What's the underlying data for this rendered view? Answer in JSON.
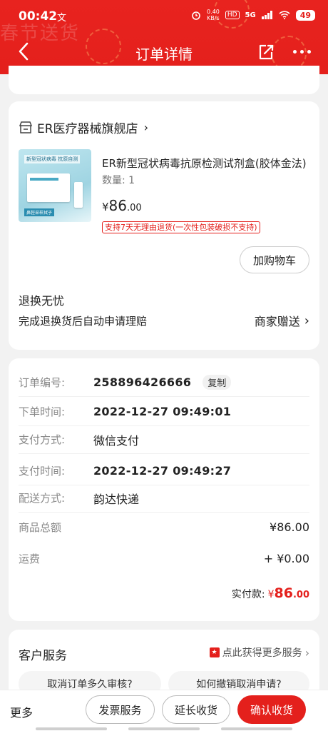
{
  "status_bar": {
    "time": "00:42",
    "speed_top": "0.40",
    "speed_bottom": "KB/s",
    "hd_tag": "HD",
    "net_tag": "5G",
    "battery": "49"
  },
  "header": {
    "title": "订单详情",
    "decoration": "春节送货"
  },
  "product_card": {
    "shop_name": "ER医疗器械旗舰店",
    "product_name": "ER新型冠状病毒抗原检测试剂盒(胶体金法)",
    "quantity": "数量: 1",
    "price_currency": "¥",
    "price_int": "86",
    "price_dec": ".00",
    "return_tag": "支持7天无理由退货(一次性包装破损不支持)",
    "add_cart_label": "加购物车",
    "worry_title": "退换无忧",
    "worry_desc": "完成退换货后自动申请理赔",
    "worry_right": "商家赠送",
    "thumb_band": "新型冠状病毒 抗原自测",
    "thumb_foot": "鼻腔采样拭子"
  },
  "order_info": {
    "order_no_label": "订单编号:",
    "order_no": "258896426666",
    "copy_label": "复制",
    "order_time_label": "下单时间:",
    "order_time": "2022-12-27 09:49:01",
    "pay_method_label": "支付方式:",
    "pay_method": "微信支付",
    "pay_time_label": "支付时间:",
    "pay_time": "2022-12-27 09:49:27",
    "ship_label": "配送方式:",
    "ship_method": "韵达快递",
    "goods_total_label": "商品总额",
    "goods_total": "¥86.00",
    "freight_label": "运费",
    "freight": "+ ¥0.00",
    "paid_label": "实付款:",
    "paid_currency": "¥",
    "paid_int": "86",
    "paid_dec": ".00"
  },
  "service": {
    "title": "客户服务",
    "link": "点此获得更多服务",
    "faq_1": "取消订单多久审核?",
    "faq_2": "如何撤销取消申请?"
  },
  "bottom_bar": {
    "more": "更多",
    "invoice": "发票服务",
    "extend": "延长收货",
    "confirm": "确认收货"
  },
  "colors": {
    "brand_red": "#e4201c"
  }
}
